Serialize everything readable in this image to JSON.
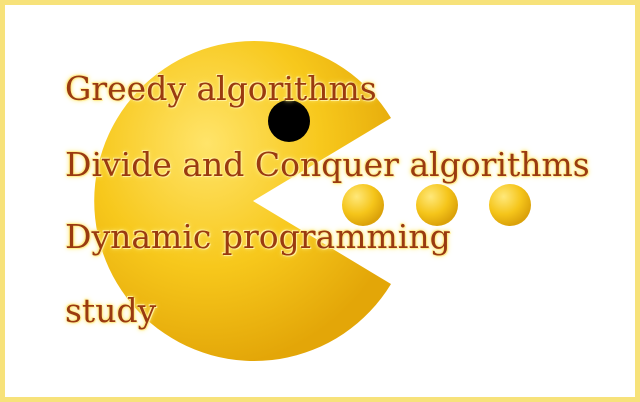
{
  "topics": [
    "Greedy algorithms",
    "Divide and Conquer algorithms",
    "Dynamic programming",
    "study"
  ],
  "colors": {
    "frame": "#f7e27a",
    "pacman": "#f5c518",
    "dot": "#f0c020",
    "eye": "#000000",
    "text": "#9a3a10"
  },
  "icons": {
    "pacman": "pacman-icon",
    "dots": "pellet-icon"
  }
}
